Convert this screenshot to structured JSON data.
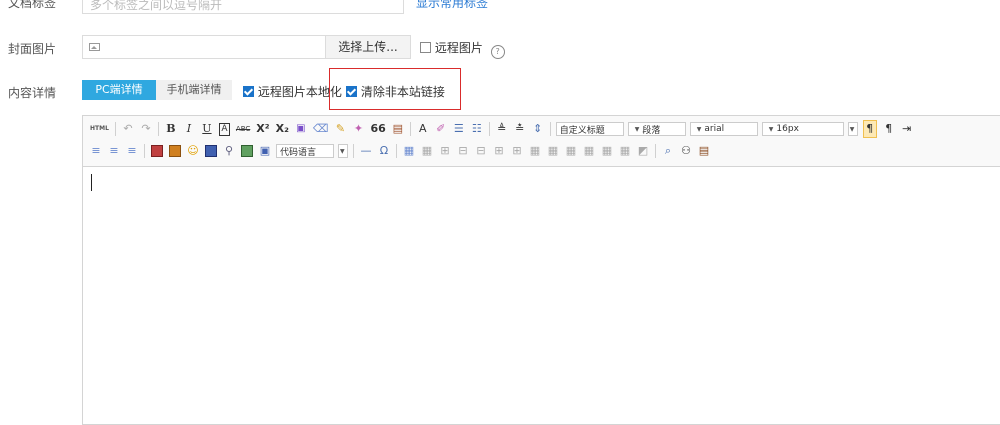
{
  "tags": {
    "label": "文档标签",
    "placeholder": "多个标签之间以逗号隔开",
    "link": "显示常用标签"
  },
  "cover": {
    "label": "封面图片",
    "upload_label": "选择上传...",
    "remote_label": "远程图片",
    "remote_checked": false
  },
  "content": {
    "label": "内容详情",
    "tabs": [
      {
        "label": "PC端详情",
        "active": true
      },
      {
        "label": "手机端详情",
        "active": false
      }
    ],
    "options": [
      {
        "label": "远程图片本地化",
        "checked": true
      },
      {
        "label": "清除非本站链接",
        "checked": true
      }
    ]
  },
  "editor": {
    "html_label": "HTML",
    "bold": "B",
    "italic": "I",
    "underline": "U",
    "strike": "ABC",
    "superscript": "X²",
    "subscript": "X₂",
    "quote": "66",
    "font_color": "A",
    "omega": "Ω",
    "hr": "—",
    "title_select": "自定义标题",
    "paragraph_select": "段落",
    "font_select": "arial",
    "size_select": "16px",
    "code_select": "代码语言"
  },
  "colors": {
    "accent": "#2fa8e0",
    "link": "#2a7ad3",
    "highlight_box": "#d92c2c",
    "checkbox": "#1a73c9"
  }
}
